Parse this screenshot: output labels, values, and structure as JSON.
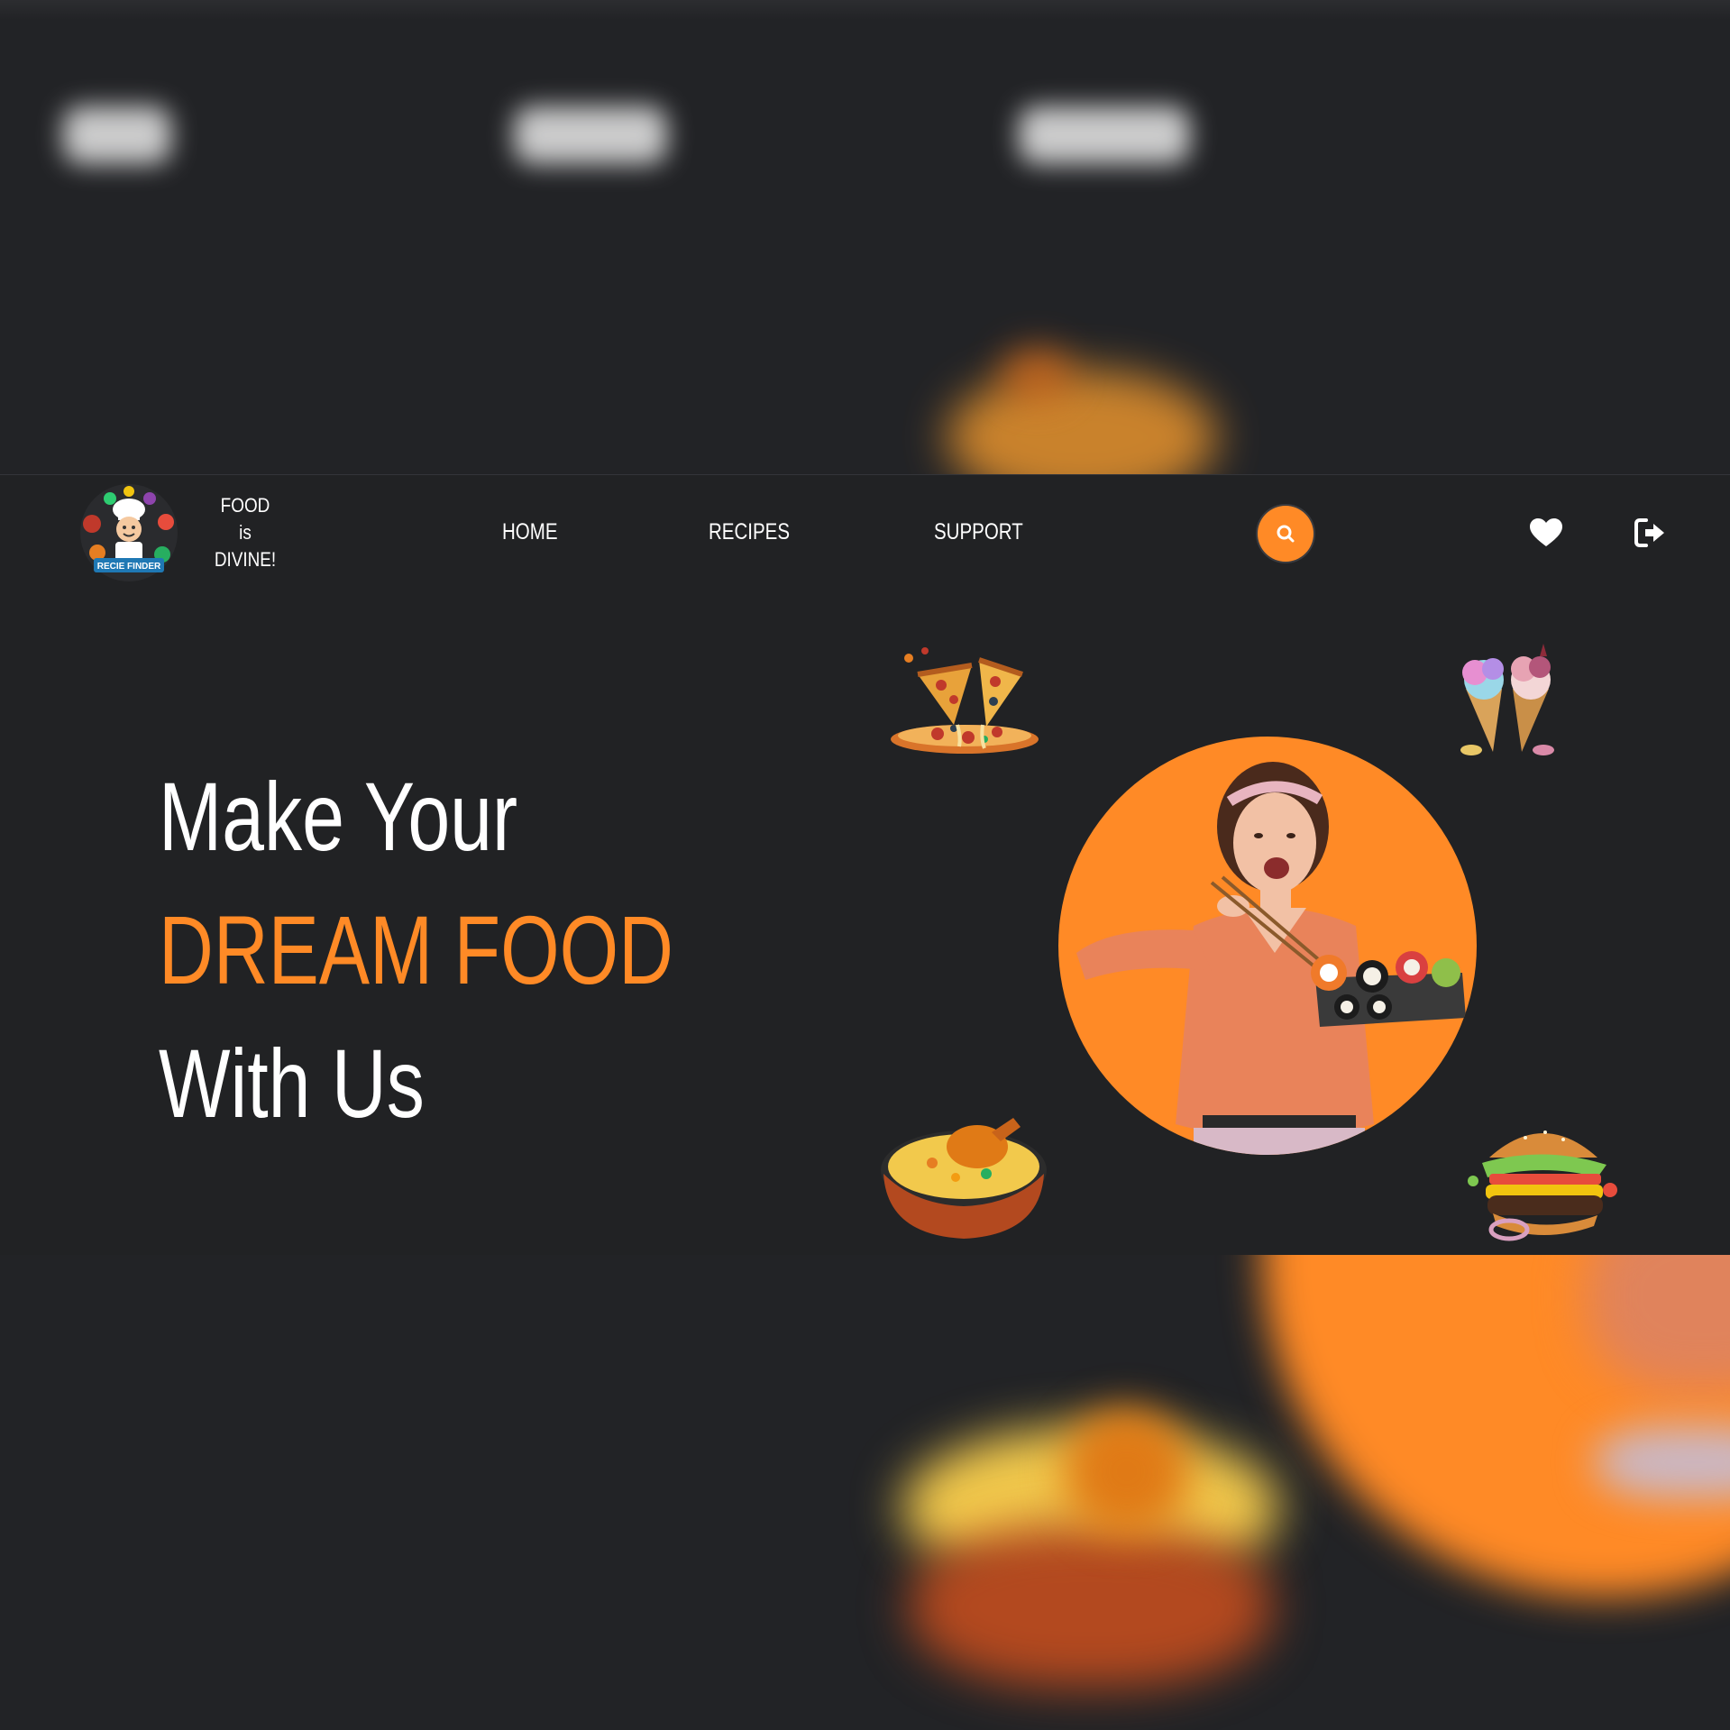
{
  "brand": {
    "logo_text": "RECIE FINDER",
    "tagline_lines": [
      "FOOD",
      "is",
      "DIVINE!"
    ]
  },
  "nav": {
    "links": [
      "HOME",
      "RECIPES",
      "SUPPORT"
    ]
  },
  "icons": {
    "search": "search-icon",
    "favorites": "heart-icon",
    "logout": "logout-icon"
  },
  "hero": {
    "line1": "Make Your",
    "line2": "DREAM FOOD",
    "line3": "With Us"
  },
  "colors": {
    "accent": "#ff8a26",
    "background": "#212224",
    "text": "#ffffff"
  }
}
